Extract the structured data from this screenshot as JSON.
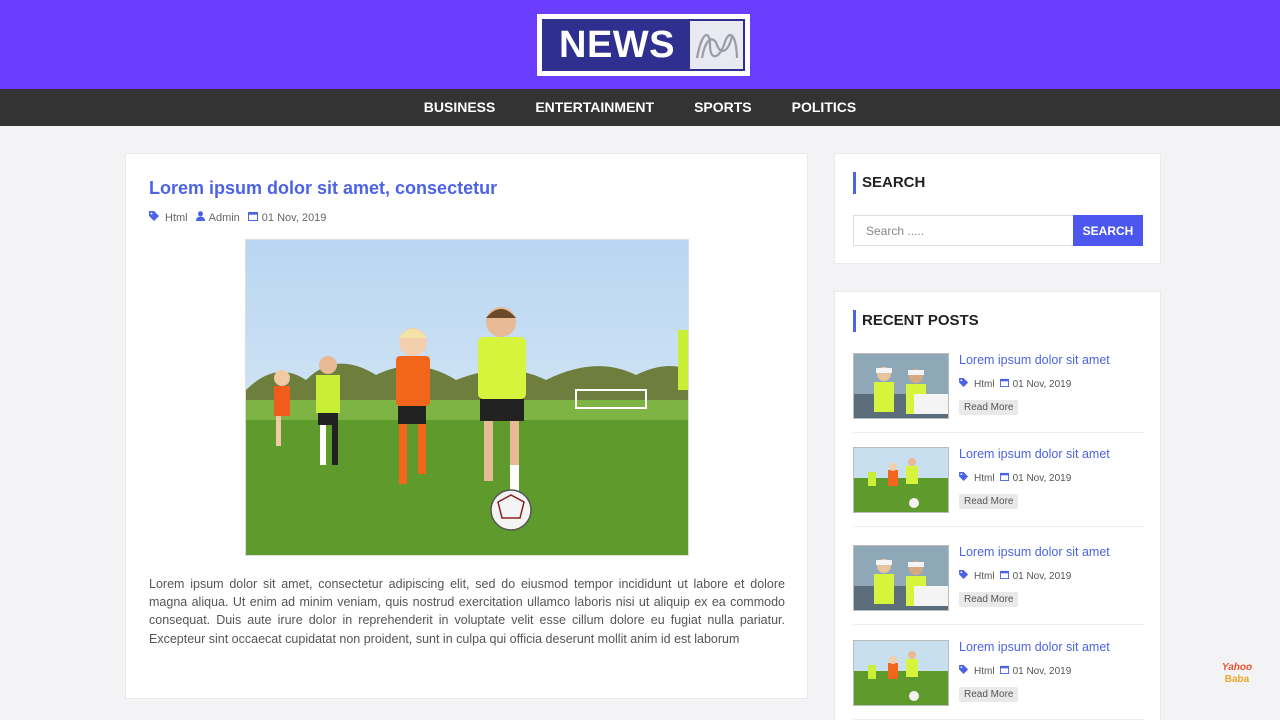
{
  "logo": {
    "text": "NEWS"
  },
  "nav": {
    "items": [
      "BUSINESS",
      "ENTERTAINMENT",
      "SPORTS",
      "POLITICS"
    ]
  },
  "post": {
    "title": "Lorem ipsum dolor sit amet, consectetur",
    "category": "Html",
    "author": "Admin",
    "date": "01 Nov, 2019",
    "body": "Lorem ipsum dolor sit amet, consectetur adipiscing elit, sed do eiusmod tempor incididunt ut labore et dolore magna aliqua. Ut enim ad minim veniam, quis nostrud exercitation ullamco laboris nisi ut aliquip ex ea commodo consequat. Duis aute irure dolor in reprehenderit in voluptate velit esse cillum dolore eu fugiat nulla pariatur. Excepteur sint occaecat cupidatat non proident, sunt in culpa qui officia deserunt mollit anim id est laborum"
  },
  "search": {
    "title": "SEARCH",
    "placeholder": "Search .....",
    "button": "SEARCH"
  },
  "recent": {
    "title": "RECENT POSTS",
    "items": [
      {
        "title": "Lorem ipsum dolor sit amet",
        "category": "Html",
        "date": "01 Nov, 2019",
        "read_more": "Read More",
        "thumb": "workers"
      },
      {
        "title": "Lorem ipsum dolor sit amet",
        "category": "Html",
        "date": "01 Nov, 2019",
        "read_more": "Read More",
        "thumb": "soccer"
      },
      {
        "title": "Lorem ipsum dolor sit amet",
        "category": "Html",
        "date": "01 Nov, 2019",
        "read_more": "Read More",
        "thumb": "workers"
      },
      {
        "title": "Lorem ipsum dolor sit amet",
        "category": "Html",
        "date": "01 Nov, 2019",
        "read_more": "Read More",
        "thumb": "soccer"
      }
    ]
  },
  "watermark": {
    "line1": "Yahoo",
    "line2": "Baba"
  },
  "colors": {
    "header": "#6a3dff",
    "navbar": "#333333",
    "accent": "#4c63e6",
    "button": "#4c57f0"
  },
  "icons": {
    "category": "tags-icon",
    "author": "user-icon",
    "date": "calendar-icon"
  }
}
